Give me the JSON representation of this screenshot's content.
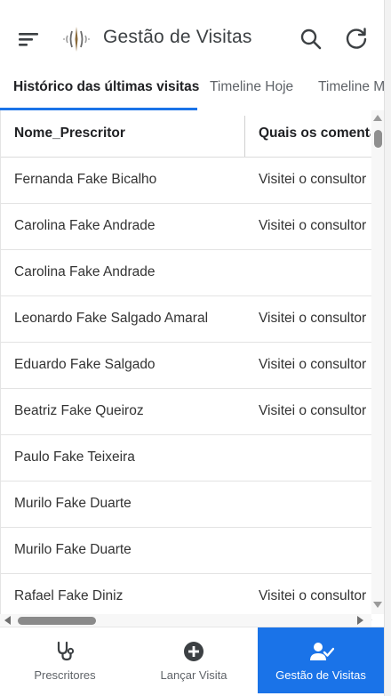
{
  "header": {
    "title": "Gestão de Visitas",
    "menu_icon": "menu-icon",
    "logo_icon": "feather-logo",
    "search_icon": "search-icon",
    "refresh_icon": "refresh-icon"
  },
  "tabs": [
    {
      "label": "Histórico das últimas visitas",
      "active": true
    },
    {
      "label": "Timeline Hoje",
      "active": false
    },
    {
      "label": "Timeline M",
      "active": false
    }
  ],
  "table": {
    "columns": [
      "Nome_Prescritor",
      "Quais os comenta"
    ],
    "rows": [
      {
        "name": "Fernanda Fake Bicalho",
        "comment": "Visitei o consultor"
      },
      {
        "name": "Carolina Fake Andrade",
        "comment": "Visitei o consultor"
      },
      {
        "name": "Carolina Fake Andrade",
        "comment": ""
      },
      {
        "name": "Leonardo Fake Salgado Amaral",
        "comment": "Visitei o consultor"
      },
      {
        "name": "Eduardo Fake Salgado",
        "comment": "Visitei o consultor"
      },
      {
        "name": "Beatriz Fake Queiroz",
        "comment": "Visitei o consultor"
      },
      {
        "name": "Paulo Fake Teixeira",
        "comment": ""
      },
      {
        "name": "Murilo Fake Duarte",
        "comment": ""
      },
      {
        "name": "Murilo Fake Duarte",
        "comment": ""
      },
      {
        "name": "Rafael Fake Diniz",
        "comment": "Visitei o consultor"
      }
    ]
  },
  "bottom_nav": [
    {
      "label": "Prescritores",
      "icon": "stethoscope-icon",
      "active": false
    },
    {
      "label": "Lançar Visita",
      "icon": "add-circle-icon",
      "active": false
    },
    {
      "label": "Gestão de Visitas",
      "icon": "user-check-icon",
      "active": true
    }
  ],
  "colors": {
    "accent": "#1a73e8",
    "text": "#202124",
    "muted": "#5f6368"
  }
}
